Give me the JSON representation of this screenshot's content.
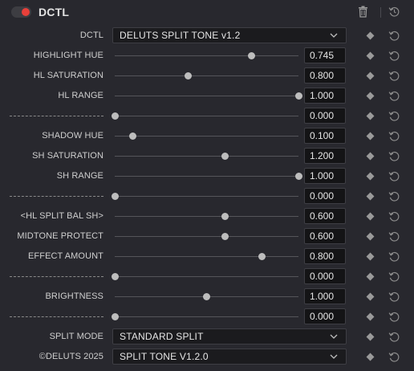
{
  "header": {
    "title": "DCTL",
    "enabled": true,
    "accent": "#e8403a",
    "icons": [
      "toggle-switch",
      "trash-icon",
      "reset-icon"
    ]
  },
  "rows": [
    {
      "type": "select",
      "label": "DCTL",
      "value": "DELUTS SPLIT TONE v1.2"
    },
    {
      "type": "slider",
      "label": "HIGHLIGHT HUE",
      "value": "0.745",
      "position": 0.745
    },
    {
      "type": "slider",
      "label": "HL SATURATION",
      "value": "0.800",
      "position": 0.4
    },
    {
      "type": "slider",
      "label": "HL RANGE",
      "value": "1.000",
      "position": 1.0
    },
    {
      "type": "slider",
      "label": "",
      "divider": true,
      "value": "0.000",
      "position": 0.0
    },
    {
      "type": "slider",
      "label": "SHADOW HUE",
      "value": "0.100",
      "position": 0.1
    },
    {
      "type": "slider",
      "label": "SH SATURATION",
      "value": "1.200",
      "position": 0.6
    },
    {
      "type": "slider",
      "label": "SH RANGE",
      "value": "1.000",
      "position": 1.0
    },
    {
      "type": "slider",
      "label": "",
      "divider": true,
      "value": "0.000",
      "position": 0.0
    },
    {
      "type": "slider",
      "label": "<HL SPLIT BAL SH>",
      "value": "0.600",
      "position": 0.6
    },
    {
      "type": "slider",
      "label": "MIDTONE PROTECT",
      "value": "0.600",
      "position": 0.6
    },
    {
      "type": "slider",
      "label": "EFFECT AMOUNT",
      "value": "0.800",
      "position": 0.8
    },
    {
      "type": "slider",
      "label": "",
      "divider": true,
      "value": "0.000",
      "position": 0.0
    },
    {
      "type": "slider",
      "label": "BRIGHTNESS",
      "value": "1.000",
      "position": 0.5
    },
    {
      "type": "slider",
      "label": "",
      "divider": true,
      "value": "0.000",
      "position": 0.0
    },
    {
      "type": "select",
      "label": "SPLIT MODE",
      "value": "STANDARD SPLIT"
    },
    {
      "type": "select",
      "label": "©DELUTS 2025",
      "value": "SPLIT TONE V1.2.0"
    }
  ]
}
